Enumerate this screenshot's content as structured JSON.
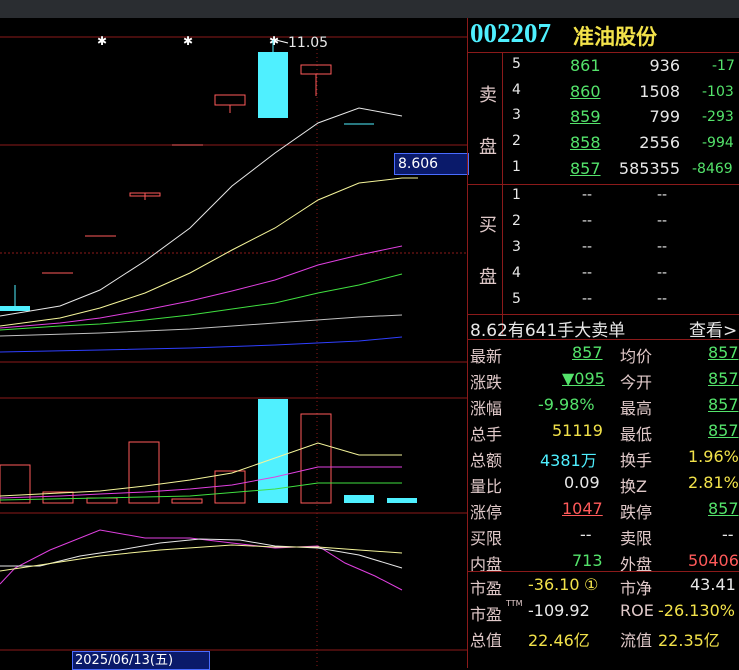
{
  "header": {
    "code": "002207",
    "name": "准油股份"
  },
  "chart": {
    "high_label": "11.05",
    "ma_value": "8.606",
    "date_label": "2025/06/13(五)"
  },
  "asks": {
    "side_label_1": "卖",
    "side_label_2": "盘",
    "rows": [
      {
        "level": "5",
        "price": "861",
        "volume": "936",
        "change": "-17"
      },
      {
        "level": "4",
        "price": "860",
        "volume": "1508",
        "change": "-103"
      },
      {
        "level": "3",
        "price": "859",
        "volume": "799",
        "change": "-293"
      },
      {
        "level": "2",
        "price": "858",
        "volume": "2556",
        "change": "-994"
      },
      {
        "level": "1",
        "price": "857",
        "volume": "585355",
        "change": "-8469"
      }
    ]
  },
  "bids": {
    "side_label_1": "买",
    "side_label_2": "盘",
    "rows": [
      {
        "level": "1",
        "price": "--",
        "volume": "--"
      },
      {
        "level": "2",
        "price": "--",
        "volume": "--"
      },
      {
        "level": "3",
        "price": "--",
        "volume": "--"
      },
      {
        "level": "4",
        "price": "--",
        "volume": "--"
      },
      {
        "level": "5",
        "price": "--",
        "volume": "--"
      }
    ]
  },
  "big_order": {
    "text": "8.62有641手大卖单",
    "link": "查看>"
  },
  "stats": [
    {
      "l1": "最新",
      "v1": "857",
      "l2": "均价",
      "v2": "857"
    },
    {
      "l1": "涨跌",
      "v1": "▼095",
      "l2": "今开",
      "v2": "857"
    },
    {
      "l1": "涨幅",
      "v1": "-9.98%",
      "l2": "最高",
      "v2": "857"
    },
    {
      "l1": "总手",
      "v1": "51119",
      "l2": "最低",
      "v2": "857"
    },
    {
      "l1": "总额",
      "v1": "4381万",
      "l2": "换手",
      "v2": "1.96%"
    },
    {
      "l1": "量比",
      "v1": "0.09",
      "l2": "换Z",
      "v2": "2.81%"
    },
    {
      "l1": "涨停",
      "v1": "1047",
      "l2": "跌停",
      "v2": "857"
    },
    {
      "l1": "买限",
      "v1": "--",
      "l2": "卖限",
      "v2": "--"
    },
    {
      "l1": "内盘",
      "v1": "713",
      "l2": "外盘",
      "v2": "50406"
    }
  ],
  "fundamentals": [
    {
      "l1": "市盈",
      "v1": "-36.10",
      "badge": "①",
      "l2": "市净",
      "v2": "43.41"
    },
    {
      "l1": "市盈",
      "sup": "TTM",
      "v1": "-109.92",
      "l2": "ROE",
      "v2": "-26.130%"
    },
    {
      "l1": "总值",
      "v1": "22.46亿",
      "l2": "流值",
      "v2": "22.35亿"
    }
  ],
  "colors": {
    "up": "#ff5a5a",
    "down": "#54e36b",
    "grid": "#8b1a1a",
    "accent": "#4ff0ff"
  }
}
